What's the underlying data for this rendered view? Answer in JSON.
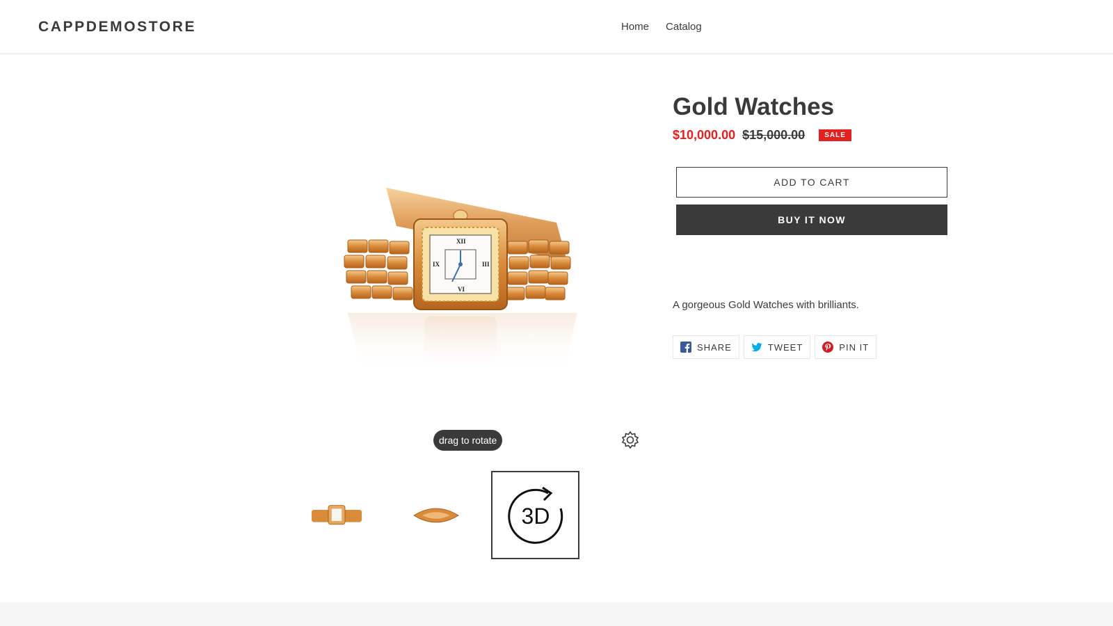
{
  "header": {
    "logo": "CAPPDEMOSTORE",
    "nav": [
      {
        "label": "Home"
      },
      {
        "label": "Catalog"
      }
    ]
  },
  "media": {
    "drag_hint": "drag to rotate",
    "thumbnails": [
      {
        "type": "image"
      },
      {
        "type": "image"
      },
      {
        "type": "3d",
        "label": "3D"
      }
    ]
  },
  "product": {
    "title": "Gold Watches",
    "price_sale": "$10,000.00",
    "price_regular": "$15,000.00",
    "badge": "SALE",
    "add_to_cart": "Add to cart",
    "buy_now": "Buy it now",
    "description": "A gorgeous Gold Watches with brilliants."
  },
  "social": {
    "share": "SHARE",
    "tweet": "TWEET",
    "pin": "PIN IT"
  },
  "colors": {
    "accent": "#e22120",
    "dark": "#3a3a3a",
    "facebook": "#3b5998",
    "twitter": "#00aced",
    "pinterest": "#cb2027"
  }
}
